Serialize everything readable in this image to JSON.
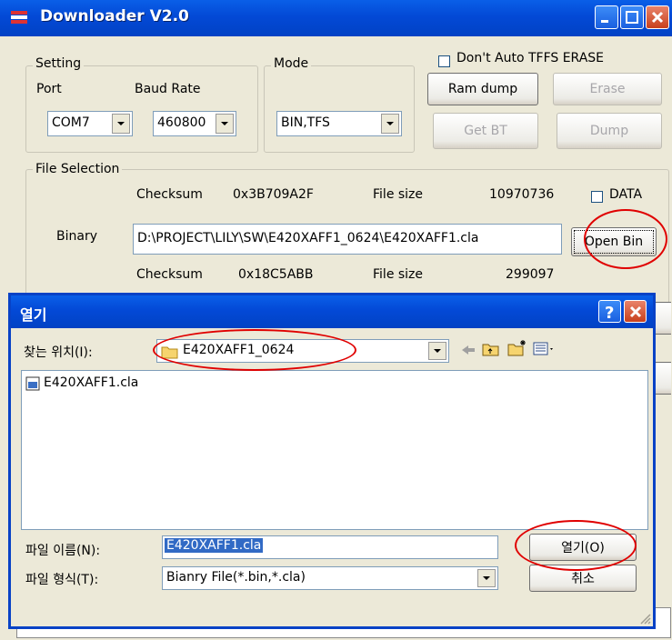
{
  "main_window": {
    "title": "Downloader V2.0",
    "setting": {
      "group_label": "Setting",
      "port_label": "Port",
      "baud_label": "Baud Rate",
      "port_value": "COM7",
      "baud_value": "460800"
    },
    "mode": {
      "group_label": "Mode",
      "value": "BIN,TFS"
    },
    "dont_auto_label": "Don't Auto TFFS ERASE",
    "buttons": {
      "ram_dump": "Ram dump",
      "erase": "Erase",
      "get_bt": "Get BT",
      "dump": "Dump",
      "open_bin": "Open Bin"
    },
    "file_selection": {
      "group_label": "File Selection",
      "checksum_label": "Checksum",
      "checksum_value": "0x3B709A2F",
      "filesize_label": "File size",
      "filesize_value": "10970736",
      "data_label": "DATA",
      "binary_label": "Binary",
      "binary_path": "D:\\PROJECT\\LILY\\SW\\E420XAFF1_0624\\E420XAFF1.cla",
      "checksum2_label": "Checksum",
      "checksum2_value": "0x18C5ABB",
      "filesize2_label": "File size",
      "filesize2_value": "299097"
    }
  },
  "open_dialog": {
    "title": "열기",
    "look_in_label": "찾는 위치(I):",
    "look_in_value": "E420XAFF1_0624",
    "files": [
      {
        "name": "E420XAFF1.cla"
      }
    ],
    "filename_label": "파일 이름(N):",
    "filename_value": "E420XAFF1.cla",
    "filetype_label": "파일 형식(T):",
    "filetype_value": "Bianry File(*.bin,*.cla)",
    "open_button": "열기(O)",
    "cancel_button": "취소"
  },
  "colors": {
    "title_blue": "#0349D6",
    "window_bg": "#ECE9D8",
    "annotation_red": "#E00000",
    "selection_blue": "#316AC5"
  }
}
